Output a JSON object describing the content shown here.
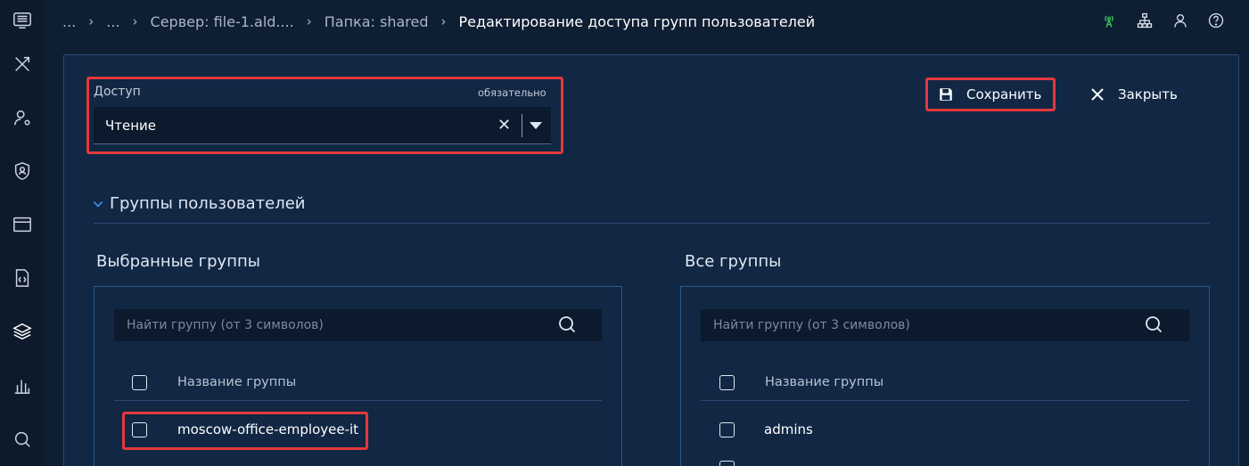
{
  "breadcrumb": {
    "items": [
      "...",
      "...",
      "Сервер: file-1.ald....",
      "Папка: shared"
    ],
    "current": "Редактирование доступа групп пользователей"
  },
  "sidebar": {
    "icons": [
      "app-logo-icon",
      "tools-icon",
      "user-settings-icon",
      "shield-user-icon",
      "window-icon",
      "code-file-icon",
      "layers-icon",
      "bar-chart-icon",
      "search-zoom-icon"
    ]
  },
  "topbar": {
    "icons": [
      "antenna-status-icon",
      "network-icon",
      "user-icon",
      "help-icon"
    ],
    "status_color": "#3ecf5a"
  },
  "form": {
    "access": {
      "label": "Доступ",
      "required": "обязательно",
      "value": "Чтение"
    },
    "save_label": "Сохранить",
    "close_label": "Закрыть"
  },
  "section": {
    "title": "Группы пользователей"
  },
  "selected": {
    "title": "Выбранные группы",
    "search_placeholder": "Найти группу (от 3 символов)",
    "column": "Название группы",
    "rows": [
      "moscow-office-employee-it"
    ]
  },
  "all": {
    "title": "Все группы",
    "search_placeholder": "Найти группу (от 3 символов)",
    "column": "Название группы",
    "rows": [
      "admins"
    ]
  },
  "colors": {
    "background": "#0e1e33",
    "panel": "#112744",
    "highlight": "#e4393c",
    "accent": "#3a8ee6"
  }
}
